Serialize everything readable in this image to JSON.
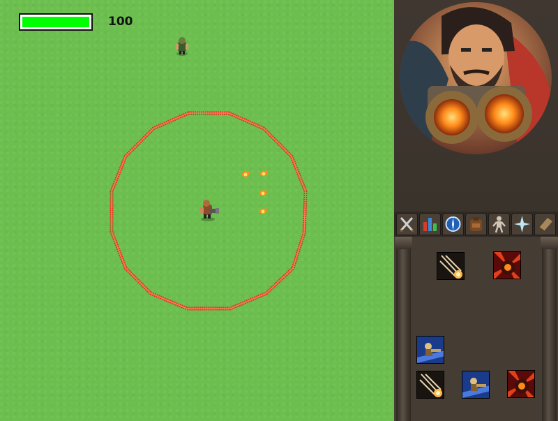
{
  "hud": {
    "health_value": "100",
    "health_fraction": 1.0,
    "health_color": "#00ff00"
  },
  "colors": {
    "grass": "#6cbf4f",
    "range_ring": "#e8321e",
    "panel_bg": "#453d34"
  },
  "sidebar": {
    "portrait": "hero-portrait",
    "tabs": [
      {
        "icon": "swords-icon"
      },
      {
        "icon": "stats-bars-icon"
      },
      {
        "icon": "compass-icon"
      },
      {
        "icon": "backpack-icon"
      },
      {
        "icon": "body-equipment-icon"
      },
      {
        "icon": "sparkle-icon"
      },
      {
        "icon": "spellbook-icon"
      }
    ],
    "skills": [
      {
        "icon": "flame-arrows-skill-icon"
      },
      {
        "icon": "fire-blast-skill-icon"
      },
      {
        "icon": "gunner-dash-skill-icon"
      },
      {
        "icon": "flame-arrows-skill-icon"
      },
      {
        "icon": "gunner-dash-skill-icon"
      },
      {
        "icon": "fire-blast-skill-icon"
      }
    ]
  }
}
